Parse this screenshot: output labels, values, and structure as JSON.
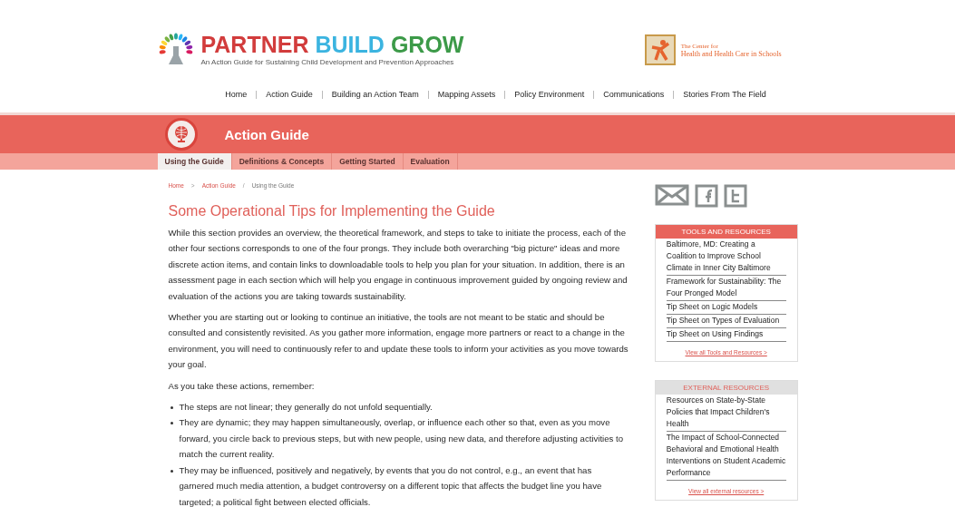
{
  "header": {
    "logo_words": [
      {
        "text": "PARTNER",
        "color": "#d23c3c"
      },
      {
        "text": "BUILD",
        "color": "#3bb4e0"
      },
      {
        "text": "GROW",
        "color": "#3c9a48"
      }
    ],
    "tagline": "An Action Guide for Sustaining Child Development and Prevention Approaches",
    "partner_line1": "The Center for",
    "partner_line2": "Health and Health Care in Schools"
  },
  "nav": [
    "Home",
    "Action Guide",
    "Building an Action Team",
    "Mapping Assets",
    "Policy Environment",
    "Communications",
    "Stories From The Field"
  ],
  "banner": {
    "title": "Action Guide"
  },
  "subtabs": [
    {
      "label": "Using the Guide",
      "selected": true
    },
    {
      "label": "Definitions & Concepts",
      "selected": false
    },
    {
      "label": "Getting Started",
      "selected": false
    },
    {
      "label": "Evaluation",
      "selected": false
    }
  ],
  "breadcrumb": [
    {
      "label": "Home",
      "kind": "link"
    },
    {
      "label": ">",
      "kind": "separator"
    },
    {
      "label": "Action Guide",
      "kind": "link"
    },
    {
      "label": "/",
      "kind": "separator"
    },
    {
      "label": "Using the Guide",
      "kind": "current"
    }
  ],
  "title": "Some Operational Tips for Implementing the Guide",
  "paragraphs": [
    "While this section provides an overview, the theoretical framework, and steps to take to initiate the process, each of the other four sections corresponds to one of the four prongs. They include both overarching \"big picture\" ideas and more discrete action items, and contain links to downloadable tools to help you plan for your situation. In addition, there is an assessment page in each section which will help you engage in continuous improvement guided by ongoing review and evaluation of the actions you are taking towards sustainability.",
    "Whether you are starting out or looking to continue an initiative, the tools are not meant to be static and should be consulted and consistently revisited. As you gather more information, engage more partners or react to a change in the environment, you will need to continuously refer to and update these tools to inform your activities as you move towards your goal.",
    "As you take these actions, remember:"
  ],
  "bullets": [
    "The steps are not linear; they generally do not unfold sequentially.",
    "They are dynamic; they may happen simultaneously, overlap, or influence each other so that, even as you move forward, you circle back to previous steps, but with new people, using new data, and therefore adjusting activities to match the current reality.",
    "They may be influenced, positively and negatively, by events that you do not control, e.g., an event that has garnered much media attention, a budget controversy on a different topic that affects the budget line you have targeted; a political fight between elected officials."
  ],
  "sidebar": {
    "boxes": [
      {
        "kind": "tools",
        "title": "TOOLS AND RESOURCES",
        "items": [
          "Baltimore, MD: Creating a Coalition to Improve School Climate in Inner City Baltimore",
          "Framework for Sustainability: The Four Pronged Model",
          "Tip Sheet on Logic Models",
          "Tip Sheet on Types of Evaluation",
          "Tip Sheet on Using Findings"
        ],
        "more": "View all Tools and Resources >"
      },
      {
        "kind": "external",
        "title": "EXTERNAL RESOURCES",
        "items": [
          "Resources on State-by-State Policies that Impact Children's Health",
          "The Impact of School-Connected Behavioral and Emotional Health Interventions on Student Academic Performance"
        ],
        "more": "View all external resources >"
      }
    ]
  }
}
